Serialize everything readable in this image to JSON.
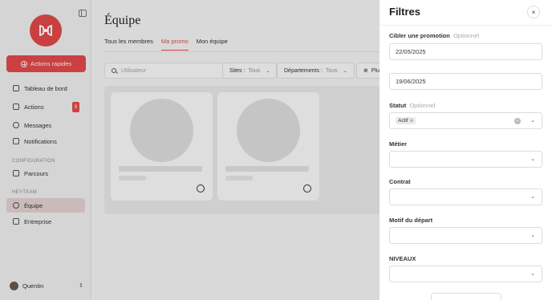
{
  "sidebar": {
    "quick_actions_label": "Actions rapides",
    "items": [
      {
        "label": "Tableau de bord"
      },
      {
        "label": "Actions",
        "badge": "9"
      },
      {
        "label": "Messages"
      },
      {
        "label": "Notifications"
      }
    ],
    "config_section": "CONFIGURATION",
    "config_items": [
      {
        "label": "Parcours"
      }
    ],
    "team_section": "HEYTEAM",
    "team_items": [
      {
        "label": "Équipe"
      },
      {
        "label": "Entreprise"
      }
    ],
    "user_name": "Quentin"
  },
  "main": {
    "title": "Équipe",
    "tabs": [
      {
        "label": "Tous les membres"
      },
      {
        "label": "Ma promo"
      },
      {
        "label": "Mon équipe"
      }
    ],
    "search_placeholder": "Utilisateur",
    "filters": {
      "sites_label": "Sites :",
      "sites_value": "Tous",
      "departments_label": "Départements :",
      "departments_value": "Tous",
      "more_label": "Plus"
    }
  },
  "drawer": {
    "title": "Filtres",
    "promotion_label": "Cibler une promotion",
    "optional": "Optionnel",
    "date_start": "22/05/2025",
    "date_end": "19/06/2025",
    "status_label": "Statut",
    "status_chip": "Actif",
    "metier_label": "Métier",
    "contrat_label": "Contrat",
    "motif_label": "Motif du départ",
    "niveaux_label": "NIVEAUX"
  },
  "colors": {
    "accent": "#e84b4b",
    "overlay": "rgba(0,0,0,0.13)"
  }
}
